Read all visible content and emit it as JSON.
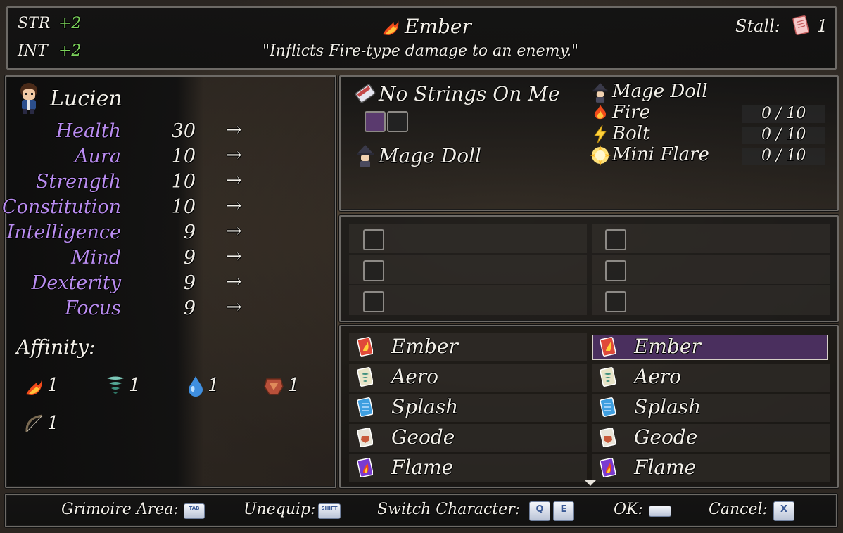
{
  "top_bar": {
    "str_label": "STR",
    "str_value": "+2",
    "int_label": "INT",
    "int_value": "+2",
    "skill_name": "Ember",
    "skill_desc": "\"Inflicts Fire-type damage to an enemy.\"",
    "stall_label": "Stall:",
    "stall_value": "1"
  },
  "character": {
    "name": "Lucien",
    "stats": [
      {
        "label": "Health",
        "value": "30",
        "arrow": "→"
      },
      {
        "label": "Aura",
        "value": "10",
        "arrow": "→"
      },
      {
        "label": "Strength",
        "value": "10",
        "arrow": "→"
      },
      {
        "label": "Constitution",
        "value": "10",
        "arrow": "→"
      },
      {
        "label": "Intelligence",
        "value": "9",
        "arrow": "→"
      },
      {
        "label": "Mind",
        "value": "9",
        "arrow": "→"
      },
      {
        "label": "Dexterity",
        "value": "9",
        "arrow": "→"
      },
      {
        "label": "Focus",
        "value": "9",
        "arrow": "→"
      }
    ],
    "affinity_label": "Affinity:",
    "affinities": [
      {
        "icon": "fire-icon",
        "value": "1"
      },
      {
        "icon": "wind-icon",
        "value": "1"
      },
      {
        "icon": "water-icon",
        "value": "1"
      },
      {
        "icon": "earth-icon",
        "value": "1"
      },
      {
        "icon": "bow-icon",
        "value": "1"
      }
    ]
  },
  "grimoire": {
    "title": "No Strings On Me",
    "doll_name": "Mage Doll",
    "right_doll_name": "Mage Doll",
    "spells": [
      {
        "name": "Fire",
        "progress": "0 / 10"
      },
      {
        "name": "Bolt",
        "progress": "0 / 10"
      },
      {
        "name": "Mini Flare",
        "progress": "0 / 10"
      }
    ]
  },
  "scroll_list_left": [
    "Ember",
    "Aero",
    "Splash",
    "Geode",
    "Flame"
  ],
  "scroll_list_right": [
    "Ember",
    "Aero",
    "Splash",
    "Geode",
    "Flame"
  ],
  "help_bar": {
    "grimoire_label": "Grimoire Area:",
    "grimoire_key": "TAB",
    "unequip_label": "Unequip:",
    "unequip_key": "SHIFT",
    "switch_label": "Switch Character:",
    "switch_key_q": "Q",
    "switch_key_e": "E",
    "ok_label": "OK:",
    "cancel_label": "Cancel:",
    "cancel_key": "X"
  },
  "colors": {
    "stat_label": "#b98cf0",
    "bonus": "#7dd45c",
    "selection": "#4a2f5e"
  }
}
